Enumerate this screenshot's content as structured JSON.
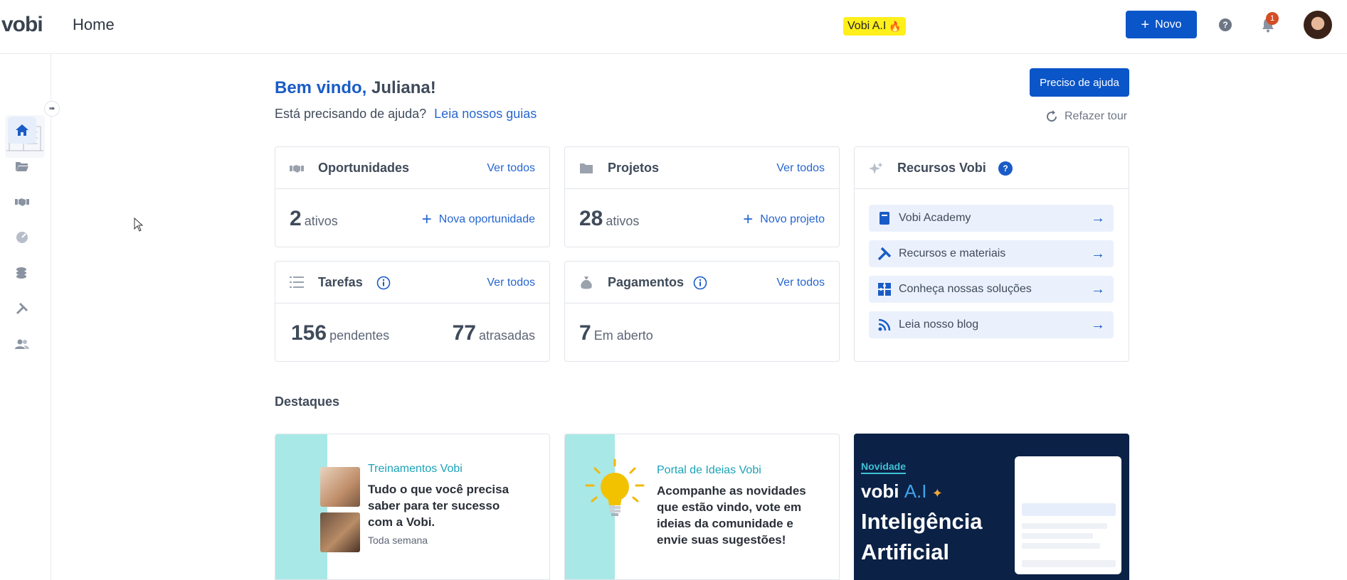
{
  "header": {
    "logo": "vobi",
    "title": "Home",
    "ai_badge": "Vobi A.I",
    "new_button": "Novo",
    "notification_count": "1"
  },
  "sidebar": {
    "items": [
      {
        "icon": "home-icon",
        "active": true
      },
      {
        "icon": "folder-icon"
      },
      {
        "icon": "handshake-icon"
      },
      {
        "icon": "dashboard-icon"
      },
      {
        "icon": "coins-icon"
      },
      {
        "icon": "tools-icon"
      },
      {
        "icon": "users-icon"
      }
    ]
  },
  "welcome": {
    "greeting": "Bem vindo,",
    "name": "Juliana!",
    "help_question": "Está precisando de ajuda?",
    "help_link": "Leia nossos guias",
    "help_button": "Preciso de ajuda",
    "redo_tour": "Refazer tour"
  },
  "cards": {
    "opportunities": {
      "title": "Oportunidades",
      "link": "Ver todos",
      "count": "2",
      "unit": "ativos",
      "action": "Nova oportunidade"
    },
    "projects": {
      "title": "Projetos",
      "link": "Ver todos",
      "count": "28",
      "unit": "ativos",
      "action": "Novo projeto"
    },
    "tasks": {
      "title": "Tarefas",
      "link": "Ver todos",
      "pending_count": "156",
      "pending_unit": "pendentes",
      "late_count": "77",
      "late_unit": "atrasadas"
    },
    "payments": {
      "title": "Pagamentos",
      "link": "Ver todos",
      "count": "7",
      "unit": "Em aberto"
    }
  },
  "resources": {
    "title": "Recursos Vobi",
    "items": [
      {
        "label": "Vobi Academy",
        "icon": "book-icon"
      },
      {
        "label": "Recursos e materiais",
        "icon": "tools-icon"
      },
      {
        "label": "Conheça nossas soluções",
        "icon": "puzzle-icon"
      },
      {
        "label": "Leia nosso blog",
        "icon": "rss-icon"
      }
    ]
  },
  "highlights": {
    "title": "Destaques",
    "training": {
      "subtitle": "Treinamentos Vobi",
      "text": "Tudo o que você precisa saber para ter sucesso com a Vobi.",
      "meta": "Toda semana"
    },
    "ideas": {
      "subtitle": "Portal de Ideias Vobi",
      "text": "Acompanhe as novidades que estão vindo, vote em ideias da comunidade e envie suas sugestões!"
    },
    "ai": {
      "tag": "Novidade",
      "logo": "vobi",
      "logo_ai": "A.I",
      "title_line1": "Inteligência",
      "title_line2": "Artificial"
    }
  },
  "colors": {
    "primary": "#0a55c8",
    "link": "#2666d0",
    "badge_yellow": "#ffef1a",
    "teal": "#a8e8e6",
    "ai_bg": "#0b2146"
  }
}
